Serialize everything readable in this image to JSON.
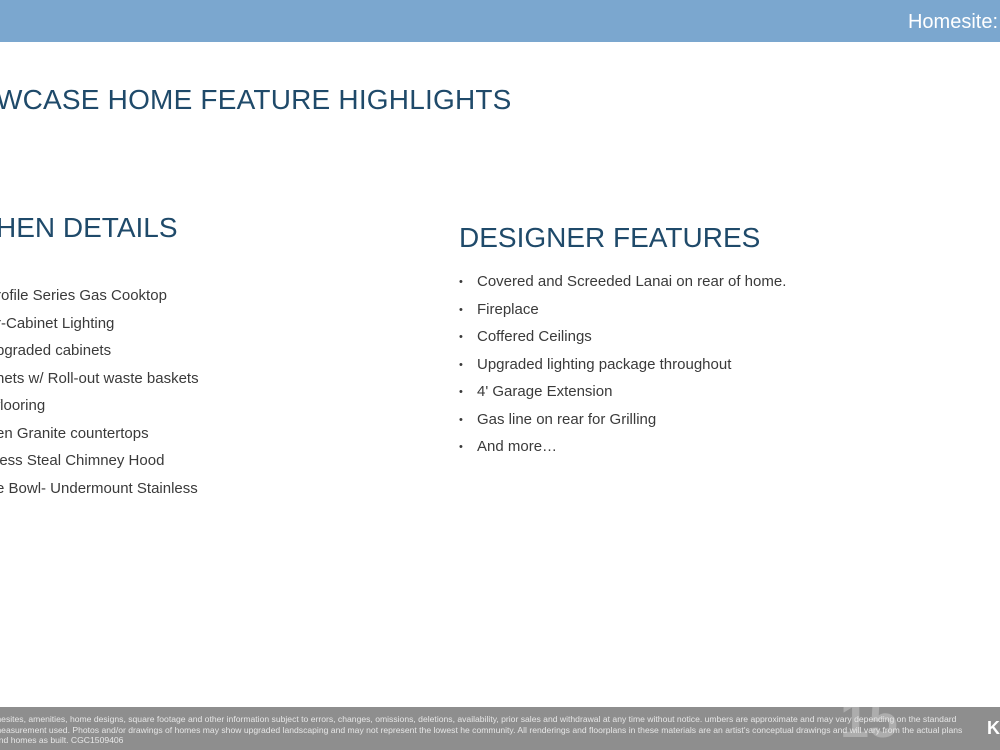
{
  "header": {
    "homesite_label": "Homesite:"
  },
  "page_title": "WCASE HOME FEATURE HIGHLIGHTS",
  "kitchen": {
    "heading": "HEN DETAILS",
    "items": [
      "rofile Series Gas Cooktop",
      "r-Cabinet Lighting",
      "pgraded cabinets",
      "nets w/ Roll-out waste baskets",
      "flooring",
      "en Granite countertops",
      "less Steal Chimney Hood",
      "e Bowl- Undermount Stainless"
    ]
  },
  "designer": {
    "heading": "DESIGNER FEATURES",
    "bullet": "•",
    "items": [
      "Covered and Screeded Lanai on rear of home.",
      "Fireplace",
      "Coffered Ceilings",
      "Upgraded lighting package throughout",
      "4' Garage Extension",
      "Gas line on rear for Grilling",
      "And more…"
    ]
  },
  "footer": {
    "disclaimer": "mesites, amenities, home designs, square footage and other information subject to errors, changes, omissions, deletions, availability, prior sales and withdrawal at any time without notice. umbers are approximate and may vary depending on the standard measurement used. Photos and/or drawings of homes may show upgraded landscaping and may not represent the lowest he community. All renderings and floorplans in these materials are an artist's conceptual drawings and will vary from the actual plans and homes as built. CGC1509406",
    "logo_text": "K",
    "watermark_text": "15"
  }
}
